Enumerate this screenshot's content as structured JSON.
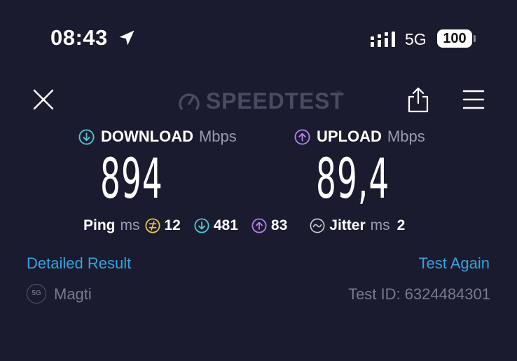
{
  "status_bar": {
    "time": "08:43",
    "network": "5G",
    "battery": "100"
  },
  "toolbar": {
    "logo_text": "SPEEDTEST",
    "logo_tm": "™"
  },
  "download": {
    "label": "DOWNLOAD",
    "unit": "Mbps",
    "value": "894",
    "color": "#4fc3cf"
  },
  "upload": {
    "label": "UPLOAD",
    "unit": "Mbps",
    "value": "89,4",
    "color": "#b27ee8"
  },
  "stats": {
    "ping_label": "Ping",
    "ping_unit": "ms",
    "ping_idle": "12",
    "ping_download": "481",
    "ping_upload": "83",
    "jitter_label": "Jitter",
    "jitter_unit": "ms",
    "jitter_value": "2",
    "idle_color": "#e6c34a"
  },
  "links": {
    "detailed_result": "Detailed Result",
    "test_again": "Test Again",
    "color": "#35a3de"
  },
  "footer": {
    "carrier_badge": "5G",
    "carrier_name": "Magti",
    "test_id_label": "Test ID:",
    "test_id_value": "6324484301"
  }
}
